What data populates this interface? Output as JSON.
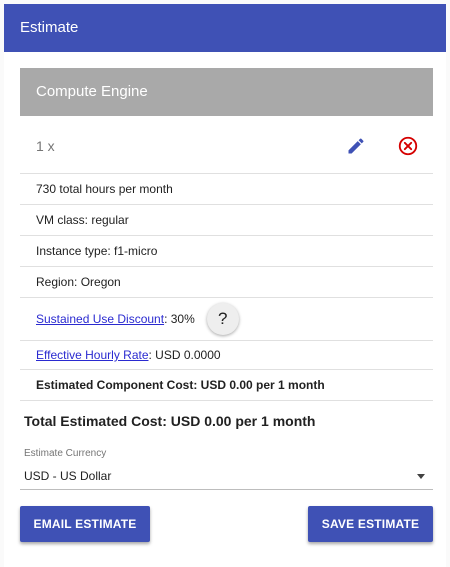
{
  "header": {
    "title": "Estimate"
  },
  "estimate": {
    "section_title": "Compute Engine",
    "quantity": "1 x",
    "edit_icon": "pencil-icon",
    "delete_icon": "close-circle-icon",
    "delete_color": "#d50000",
    "details": {
      "hours": "730 total hours per month",
      "vm_class": "VM class: regular",
      "instance_type": "Instance type: f1-micro",
      "region": "Region: Oregon",
      "sustained_link": "Sustained Use Discount",
      "sustained_value": ": 30%",
      "help_label": "?",
      "hourly_link": "Effective Hourly Rate",
      "hourly_value": ": USD 0.0000",
      "component_cost": "Estimated Component Cost: USD 0.00 per 1 month"
    },
    "total": "Total Estimated Cost: USD 0.00 per 1 month",
    "currency": {
      "label": "Estimate Currency",
      "selected": "USD - US Dollar"
    },
    "buttons": {
      "email": "EMAIL ESTIMATE",
      "save": "SAVE ESTIMATE"
    }
  },
  "colors": {
    "accent": "#3f51b5",
    "section_bg": "#a9a9a9",
    "link": "#2a2ad0"
  }
}
